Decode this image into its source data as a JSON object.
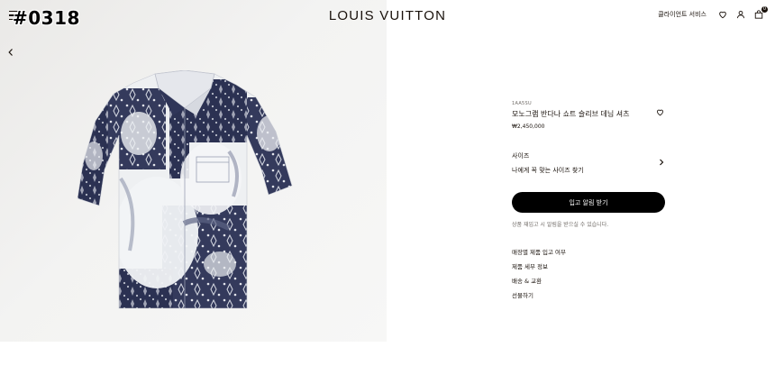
{
  "watermark": "#0318",
  "header": {
    "menu_icon": "menu-icon",
    "brand": "LOUIS VUITTON",
    "client_services": "클라이언트 서비스",
    "icons": [
      "heart-icon",
      "user-icon",
      "bag-icon"
    ],
    "bag_count": "0"
  },
  "gallery": {
    "back_icon": "chevron-left-icon",
    "image": "monogram bandana short-sleeved denim shirt"
  },
  "product": {
    "sku": "1AA5SU",
    "name": "모노그램 반다나 쇼트 슬리브 데님 셔츠",
    "price": "₩2,450,000",
    "size_label": "사이즈",
    "size_finder": "나에게 꼭 맞는 사이즈 찾기",
    "cta": "입고 알림 받기",
    "notice": "상품 재입고 시 알림을 받으실 수 있습니다.",
    "links": [
      "매장별 제품 입고 여부",
      "제품 세부 정보",
      "배송 & 교환",
      "선물하기"
    ]
  },
  "colors": {
    "text": "#19110b",
    "cta_bg": "#000000",
    "gallery_bg": "#eeeeec",
    "shirt_navy": "#2b3152",
    "shirt_light": "#eef0f2"
  }
}
